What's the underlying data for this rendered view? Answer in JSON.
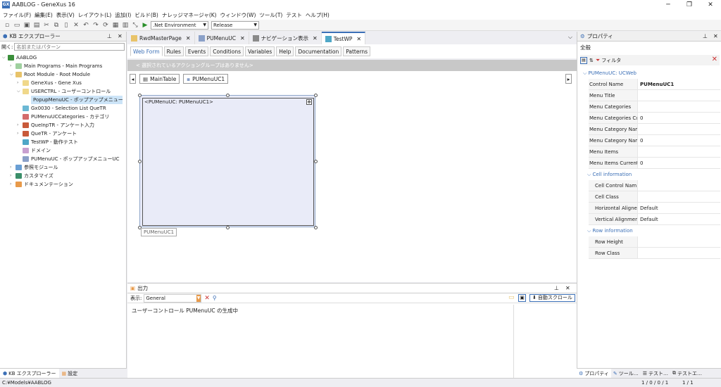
{
  "window": {
    "title": "AABLOG - GeneXus 16",
    "icon": "GX"
  },
  "menu": [
    "ファイル(F)",
    "編集(E)",
    "表示(V)",
    "レイアウト(L)",
    "追加(I)",
    "ビルド(B)",
    "ナレッジマネージャ(K)",
    "ウィンドウ(W)",
    "ツール(T)",
    "テスト",
    "ヘルプ(H)"
  ],
  "toolbar": {
    "environment": ".Net Environment",
    "configuration": "Release"
  },
  "kb_explorer": {
    "title": "KB エクスプローラー",
    "search_label": "開く:",
    "search_placeholder": "名前またはパターン",
    "items": [
      {
        "label": "AABLOG",
        "icon": "kb-icon"
      },
      {
        "label": "Main Programs - Main Programs",
        "icon": "folder-icon"
      },
      {
        "label": "Root Module - Root Module",
        "icon": "module-icon"
      },
      {
        "label": "GeneXus - Gene Xus",
        "icon": "folder-icon"
      },
      {
        "label": "USERCTRL - ユーザーコントロール",
        "icon": "folder-icon"
      },
      {
        "label": "PopupMenuUC - ポップアップメニュー",
        "icon": "usercontrol-icon"
      },
      {
        "label": "Gx0030 - Selection List QueTR",
        "icon": "webpanel-icon"
      },
      {
        "label": "PUMenuUCCategories - カテゴリ",
        "icon": "sdt-icon"
      },
      {
        "label": "QueInpTR - アンケート入力",
        "icon": "transaction-icon"
      },
      {
        "label": "QueTR - アンケート",
        "icon": "transaction-icon"
      },
      {
        "label": "TestWP - 動作テスト",
        "icon": "webpanel-icon"
      },
      {
        "label": "ドメイン",
        "icon": "domain-icon"
      },
      {
        "label": "PUMenuUC - ポップアップメニューUC",
        "icon": "usercontrol-icon"
      },
      {
        "label": "参照モジュール",
        "icon": "reference-icon"
      },
      {
        "label": "カスタマイズ",
        "icon": "customize-icon"
      },
      {
        "label": "ドキュメンテーション",
        "icon": "documentation-icon"
      }
    ],
    "bottom_tabs": [
      "KB エクスプローラー",
      "設定"
    ]
  },
  "doc_tabs": [
    {
      "label": "RwdMasterPage"
    },
    {
      "label": "PUMenuUC"
    },
    {
      "label": "ナビゲーション表示"
    },
    {
      "label": "TestWP"
    }
  ],
  "inner_tabs": [
    "Web Form",
    "Rules",
    "Events",
    "Conditions",
    "Variables",
    "Help",
    "Documentation",
    "Patterns"
  ],
  "action_bar": "< 選択されているアクショングループはありません>",
  "breadcrumb": [
    "MainTable",
    "PUMenuUC1"
  ],
  "uc": {
    "header": "<PUMenuUC: PUMenuUC1>",
    "caption": "PUMenuUC1"
  },
  "output": {
    "title": "出力",
    "show_label": "表示:",
    "show_value": "General",
    "autoscroll": "自動スクロール",
    "message": "ユーザーコントロール PUMenuUC の生成中"
  },
  "properties": {
    "title": "プロパティ",
    "tab": "全般",
    "filter_label": "フィルタ",
    "object_header": "PUMenuUC: UCWeb",
    "rows": [
      {
        "k": "Control Name",
        "v": "PUMenuUC1"
      },
      {
        "k": "Menu Title",
        "v": ""
      },
      {
        "k": "Menu Categories",
        "v": ""
      },
      {
        "k": "Menu Categories Cu",
        "v": "0"
      },
      {
        "k": "Menu Category Nam",
        "v": ""
      },
      {
        "k": "Menu Category Nam",
        "v": "0"
      },
      {
        "k": "Menu Items",
        "v": ""
      },
      {
        "k": "Menu Items Current",
        "v": "0"
      }
    ],
    "cell_section": "Cell information",
    "cell_rows": [
      {
        "k": "Cell Control Nam",
        "v": ""
      },
      {
        "k": "Cell Class",
        "v": ""
      },
      {
        "k": "Horizontal Aligne",
        "v": "Default"
      },
      {
        "k": "Vertical Alignmer",
        "v": "Default"
      }
    ],
    "row_section": "Row information",
    "row_rows": [
      {
        "k": "Row Height",
        "v": ""
      },
      {
        "k": "Row Class",
        "v": ""
      }
    ],
    "bottom_tabs": [
      "プロパティ",
      "ツール…",
      "テスト…",
      "テストエ…"
    ]
  },
  "status": {
    "path": "C:¥Models¥AABLOG",
    "counts": "1 / 0 / 0 / 1",
    "position": "1 / 1"
  },
  "colors": {
    "accent": "#3b6fb6",
    "selection": "#cce4f7",
    "canvas_fill": "#e9ebf8"
  }
}
